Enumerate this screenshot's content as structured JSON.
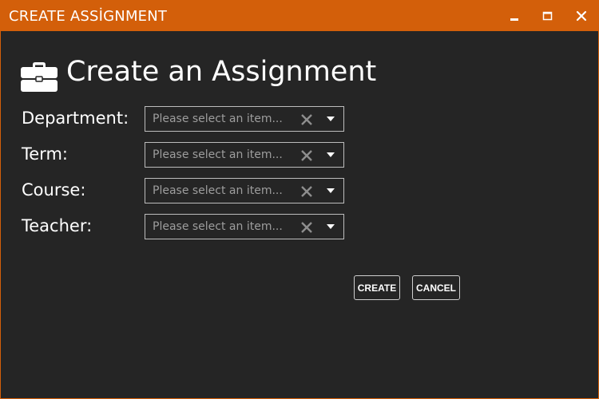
{
  "window": {
    "title": "CREATE ASSİGNMENT",
    "accent_color": "#d35f0a",
    "background_color": "#252525",
    "controls": {
      "minimize_icon": "minimize-icon",
      "maximize_icon": "maximize-icon",
      "close_icon": "close-icon"
    }
  },
  "heading": {
    "icon": "briefcase-icon",
    "title": "Create an Assignment"
  },
  "form": {
    "fields": [
      {
        "label": "Department:",
        "placeholder": "Please select an item..."
      },
      {
        "label": "Term:",
        "placeholder": "Please select an item..."
      },
      {
        "label": "Course:",
        "placeholder": "Please select an item..."
      },
      {
        "label": "Teacher:",
        "placeholder": "Please select an item..."
      }
    ],
    "clear_icon": "clear-x-icon",
    "dropdown_icon": "dropdown-arrow-icon"
  },
  "actions": {
    "create_label": "CREATE",
    "cancel_label": "CANCEL"
  }
}
